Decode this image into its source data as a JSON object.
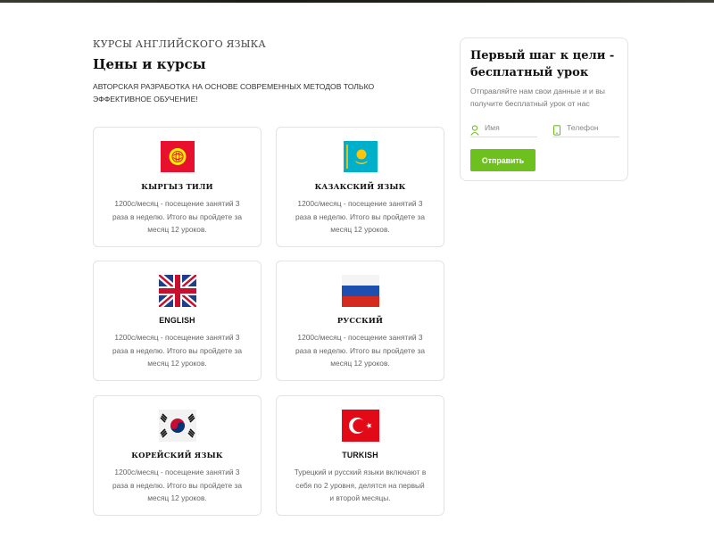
{
  "header": {
    "eyebrow": "КУРСЫ АНГЛИЙСКОГО ЯЗЫКА",
    "title": "Цены и курсы",
    "subtitle": "АВТОРСКАЯ РАЗРАБОТКА НА ОСНОВЕ СОВРЕМЕННЫХ МЕТОДОВ ТОЛЬКО ЭФФЕКТИВНОЕ ОБУЧЕНИЕ!"
  },
  "courses": [
    {
      "flag": "kyrgyzstan-flag-icon",
      "title": "КЫРГЫЗ ТИЛИ",
      "desc": "1200с/месяц - посещение занятий 3 раза в неделю. Итого вы пройдете за месяц 12 уроков."
    },
    {
      "flag": "kazakhstan-flag-icon",
      "title": "КАЗАКСКИЙ ЯЗЫК",
      "desc": "1200с/месяц - посещение занятий 3 раза в неделю. Итого вы пройдете за месяц 12 уроков."
    },
    {
      "flag": "uk-flag-icon",
      "title": "ENGLISH",
      "desc": "1200с/месяц - посещение занятий 3 раза в неделю. Итого вы пройдете за месяц 12 уроков."
    },
    {
      "flag": "russia-flag-icon",
      "title": "РУССКИЙ",
      "desc": "1200с/месяц - посещение занятий 3 раза в неделю. Итого вы пройдете за месяц 12 уроков."
    },
    {
      "flag": "south-korea-flag-icon",
      "title": "КОРЕЙСКИЙ ЯЗЫК",
      "desc": "1200с/месяц - посещение занятий 3 раза в неделю. Итого вы пройдете за месяц 12 уроков."
    },
    {
      "flag": "turkey-flag-icon",
      "title": "TURKISH",
      "desc": "Турецкий и русский языки включают в себя по 2 уровня, делятся на первый и второй месяцы."
    }
  ],
  "form": {
    "title": "Первый шаг к цели - бесплатный урок",
    "subtitle": "Отправляйте нам свои данные и и вы получите бесплатный урок от нас",
    "name_placeholder": "Имя",
    "phone_placeholder": "Телефон",
    "submit_label": "Отправить"
  },
  "colors": {
    "accent_green": "#6ec01e",
    "card_border": "#e3e3e3"
  }
}
